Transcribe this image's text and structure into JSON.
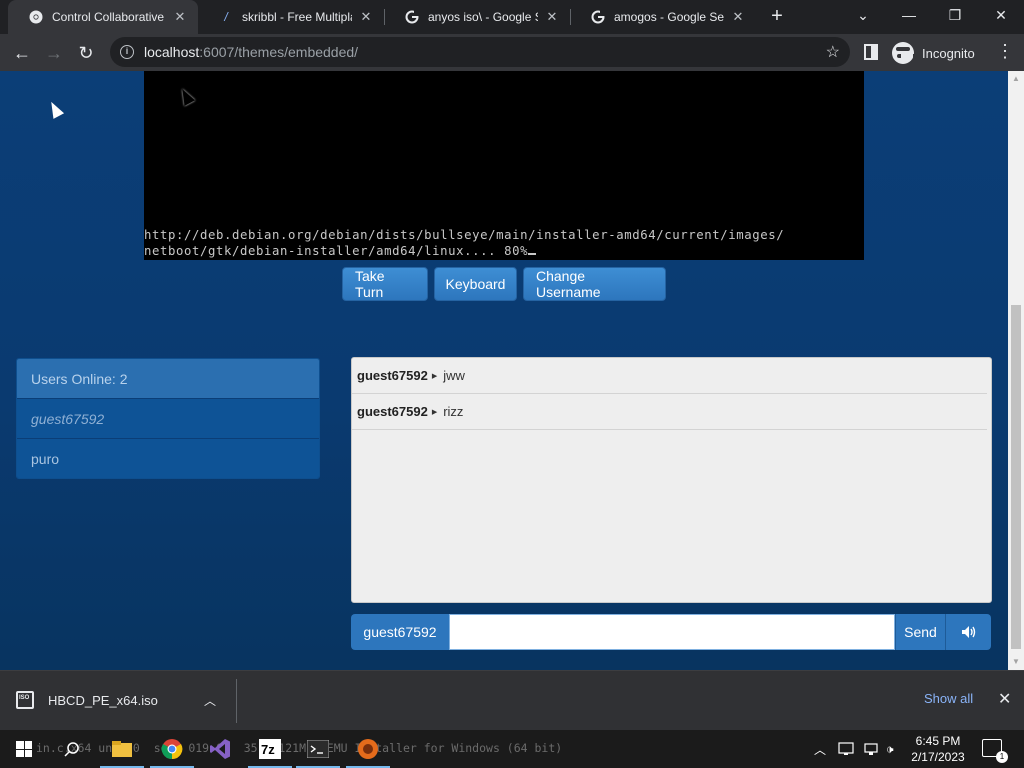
{
  "browser": {
    "tabs": [
      {
        "title": "Control Collaborative V",
        "favicon": "chrome-icon",
        "active": true
      },
      {
        "title": "skribbl - Free Multiplay",
        "favicon": "skribbl-pencil-icon",
        "active": false
      },
      {
        "title": "anyos iso\\ - Google Sea",
        "favicon": "google-icon",
        "active": false
      },
      {
        "title": "amogos - Google Searc",
        "favicon": "google-icon",
        "active": false
      }
    ],
    "url_host": "localhost",
    "url_path": ":6007/themes/embedded/",
    "profile_label": "Incognito"
  },
  "vm": {
    "console_line1": "http://deb.debian.org/debian/dists/bullseye/main/installer-amd64/current/images/",
    "console_line2": "netboot/gtk/debian-installer/amd64/linux.... 80%"
  },
  "controls": {
    "take_turn": "Take Turn",
    "keyboard": "Keyboard",
    "change_username": "Change Username"
  },
  "users": {
    "header": "Users Online: 2",
    "list": [
      "guest67592",
      "puro"
    ]
  },
  "chat": {
    "messages": [
      {
        "user": "guest67592",
        "text": "jww"
      },
      {
        "user": "guest67592",
        "text": "rizz"
      }
    ],
    "username_label": "guest67592",
    "input_value": "",
    "send_label": "Send"
  },
  "downloads": {
    "filename": "HBCD_PE_x64.iso",
    "show_all": "Show all"
  },
  "taskbar": {
    "ghost_text": "in.c.x64 un  20  se   019 08  35   121M  QEMU Installer for Windows (64 bit)",
    "time": "6:45 PM",
    "date": "2/17/2023"
  },
  "colors": {
    "page_bg": "#0b3e77",
    "button_blue": "#2d76bd",
    "chrome_dark": "#202124"
  }
}
